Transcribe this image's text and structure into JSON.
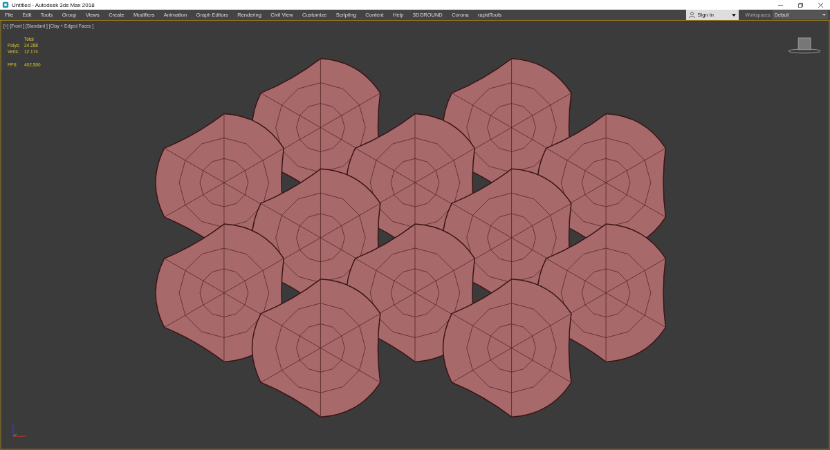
{
  "window": {
    "title": "Untitled - Autodesk 3ds Max 2018"
  },
  "menu": [
    "File",
    "Edit",
    "Tools",
    "Group",
    "Views",
    "Create",
    "Modifiers",
    "Animation",
    "Graph Editors",
    "Rendering",
    "Civil View",
    "Customize",
    "Scripting",
    "Content",
    "Help",
    "3DGROUND",
    "Corona",
    "rapidTools"
  ],
  "sign_in": {
    "label": "Sign In"
  },
  "workspaces": {
    "label": "Workspaces:",
    "value": "Default"
  },
  "viewport": {
    "labels": [
      "[+]",
      "[Front ]",
      "[Standard ]",
      "[Clay + Edged Faces ]"
    ],
    "stats": {
      "header": "Total",
      "rows": [
        {
          "name": "Polys:",
          "value": "24 288"
        },
        {
          "name": "Verts:",
          "value": "12 174"
        }
      ],
      "fps": {
        "name": "FPS:",
        "value": "402,560"
      }
    }
  }
}
